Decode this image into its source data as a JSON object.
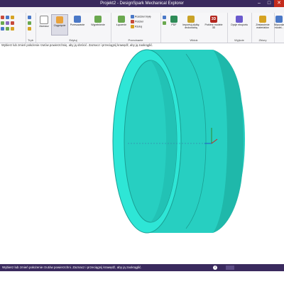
{
  "window": {
    "title": "Projekt2 - DesignSpark Mechanical Explorer"
  },
  "ribbon": {
    "groups": [
      {
        "label": "Tryb"
      },
      {
        "label": "Edytuj"
      },
      {
        "label": "Przecinanie"
      },
      {
        "label": "Widok"
      },
      {
        "label": "Wyjście"
      },
      {
        "label": "Zbiory"
      }
    ],
    "tools": {
      "select": "Zaznacz",
      "pull": "Ciągnięcie",
      "move": "Przesuwanie",
      "fill": "Wypełnienie",
      "combine": "Łączenie",
      "split_body": "Rozdziel bryłę",
      "split": "Podziel",
      "project": "Rzutuj",
      "pdf": "PDF",
      "import_pcb": "Importuj płytkę drukowaną",
      "view_3d": "Pobierz modele 3D",
      "export": "Opcje eksportu",
      "bom": "Zestawienie materiałów",
      "more": "Wyszukaj model..."
    }
  },
  "hint": "Wybierz lub zmień położenie rzutów powierzchnię, aby ją obrócić. Zaznacz i przeciągnij krawędź, aby ją zaokrąglić.",
  "status": {
    "message": "Wybierz lub zmień położenie rzutów powierzchni. Zaznacz i przeciągnij krawędź, aby ją zaokrąglić."
  },
  "colors": {
    "model": "#2ee6d6",
    "model_dark": "#1fb8aa",
    "model_inner": "#27cfc1",
    "chrome": "#3a2a5e"
  }
}
